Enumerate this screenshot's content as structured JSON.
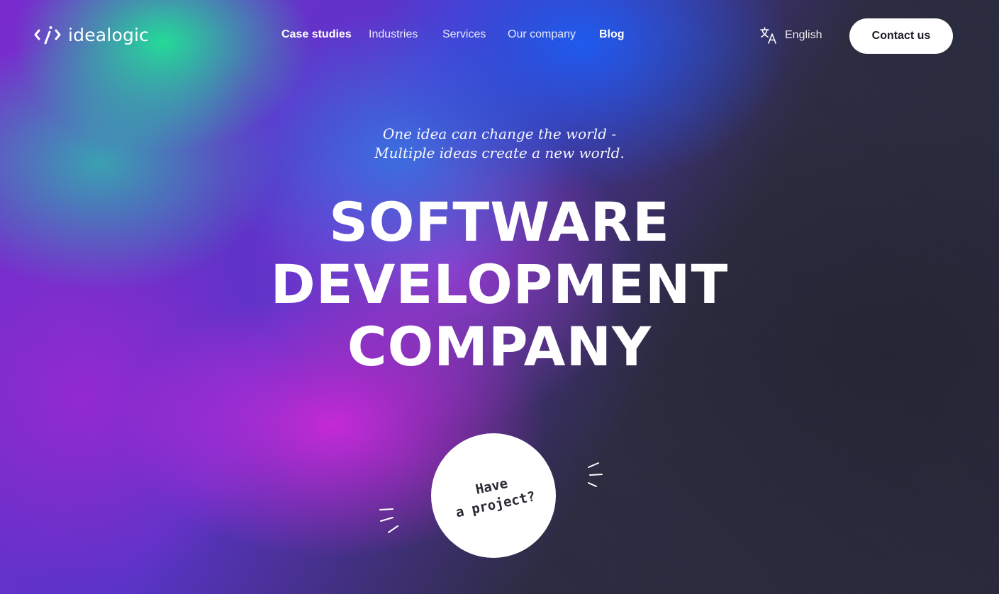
{
  "brand": {
    "name": "idealogic",
    "logo_icon": "code-slash-icon"
  },
  "nav": {
    "items": [
      {
        "label": "Case studies"
      },
      {
        "label": "Industries"
      },
      {
        "label": "Services"
      },
      {
        "label": "Our company"
      },
      {
        "label": "Blog"
      }
    ]
  },
  "language": {
    "icon": "translate-icon",
    "label": "English"
  },
  "contact": {
    "label": "Contact us"
  },
  "hero": {
    "tagline_line1": "One idea can change the world -",
    "tagline_line2": "Multiple ideas create a new world.",
    "headline_line1": "SOFTWARE",
    "headline_line2": "DEVELOPMENT",
    "headline_line3": "COMPANY",
    "cta_line1": "Have",
    "cta_line2": "a project?"
  },
  "colors": {
    "accent_green": "#1ee696",
    "accent_blue": "#1e5af0",
    "accent_magenta": "#cd28dc",
    "accent_purple": "#962ad2",
    "dark": "#28283a",
    "button_bg": "#ffffff",
    "button_text": "#1b1b24"
  }
}
